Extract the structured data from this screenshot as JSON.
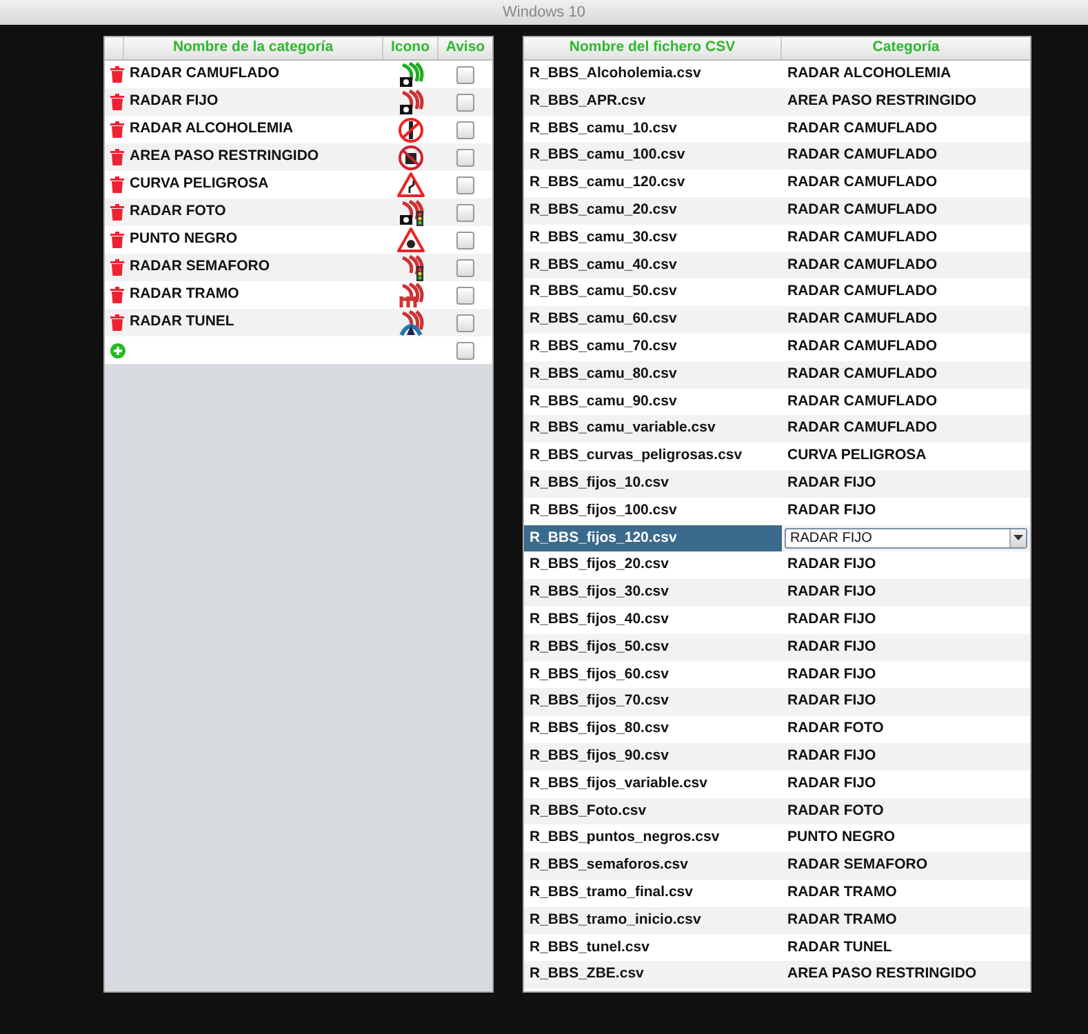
{
  "window": {
    "title": "Windows 10"
  },
  "categories": {
    "columns": [
      "Nombre de la categoría",
      "Icono",
      "Aviso"
    ],
    "rows": [
      {
        "name": "RADAR CAMUFLADO",
        "checked": false
      },
      {
        "name": "RADAR FIJO",
        "checked": false
      },
      {
        "name": "RADAR ALCOHOLEMIA",
        "checked": false
      },
      {
        "name": "AREA PASO RESTRINGIDO",
        "checked": false
      },
      {
        "name": "CURVA PELIGROSA",
        "checked": false
      },
      {
        "name": "RADAR FOTO",
        "checked": false
      },
      {
        "name": "PUNTO NEGRO",
        "checked": false
      },
      {
        "name": "RADAR SEMAFORO",
        "checked": false
      },
      {
        "name": "RADAR TRAMO",
        "checked": false
      },
      {
        "name": "RADAR TUNEL",
        "checked": false
      }
    ],
    "new_row": {
      "checked": false
    }
  },
  "files": {
    "columns": [
      "Nombre del fichero CSV",
      "Categoría"
    ],
    "rows": [
      {
        "file": "R_BBS_Alcoholemia.csv",
        "category": "RADAR ALCOHOLEMIA",
        "selected": false
      },
      {
        "file": "R_BBS_APR.csv",
        "category": "AREA PASO RESTRINGIDO",
        "selected": false
      },
      {
        "file": "R_BBS_camu_10.csv",
        "category": "RADAR CAMUFLADO",
        "selected": false
      },
      {
        "file": "R_BBS_camu_100.csv",
        "category": "RADAR CAMUFLADO",
        "selected": false
      },
      {
        "file": "R_BBS_camu_120.csv",
        "category": "RADAR CAMUFLADO",
        "selected": false
      },
      {
        "file": "R_BBS_camu_20.csv",
        "category": "RADAR CAMUFLADO",
        "selected": false
      },
      {
        "file": "R_BBS_camu_30.csv",
        "category": "RADAR CAMUFLADO",
        "selected": false
      },
      {
        "file": "R_BBS_camu_40.csv",
        "category": "RADAR CAMUFLADO",
        "selected": false
      },
      {
        "file": "R_BBS_camu_50.csv",
        "category": "RADAR CAMUFLADO",
        "selected": false
      },
      {
        "file": "R_BBS_camu_60.csv",
        "category": "RADAR CAMUFLADO",
        "selected": false
      },
      {
        "file": "R_BBS_camu_70.csv",
        "category": "RADAR CAMUFLADO",
        "selected": false
      },
      {
        "file": "R_BBS_camu_80.csv",
        "category": "RADAR CAMUFLADO",
        "selected": false
      },
      {
        "file": "R_BBS_camu_90.csv",
        "category": "RADAR CAMUFLADO",
        "selected": false
      },
      {
        "file": "R_BBS_camu_variable.csv",
        "category": "RADAR CAMUFLADO",
        "selected": false
      },
      {
        "file": "R_BBS_curvas_peligrosas.csv",
        "category": "CURVA PELIGROSA",
        "selected": false
      },
      {
        "file": "R_BBS_fijos_10.csv",
        "category": "RADAR FIJO",
        "selected": false
      },
      {
        "file": "R_BBS_fijos_100.csv",
        "category": "RADAR FIJO",
        "selected": false
      },
      {
        "file": "R_BBS_fijos_120.csv",
        "category": "RADAR FIJO",
        "selected": true
      },
      {
        "file": "R_BBS_fijos_20.csv",
        "category": "RADAR FIJO",
        "selected": false
      },
      {
        "file": "R_BBS_fijos_30.csv",
        "category": "RADAR FIJO",
        "selected": false
      },
      {
        "file": "R_BBS_fijos_40.csv",
        "category": "RADAR FIJO",
        "selected": false
      },
      {
        "file": "R_BBS_fijos_50.csv",
        "category": "RADAR FIJO",
        "selected": false
      },
      {
        "file": "R_BBS_fijos_60.csv",
        "category": "RADAR FIJO",
        "selected": false
      },
      {
        "file": "R_BBS_fijos_70.csv",
        "category": "RADAR FIJO",
        "selected": false
      },
      {
        "file": "R_BBS_fijos_80.csv",
        "category": "RADAR FOTO",
        "selected": false
      },
      {
        "file": "R_BBS_fijos_90.csv",
        "category": "RADAR FIJO",
        "selected": false
      },
      {
        "file": "R_BBS_fijos_variable.csv",
        "category": "RADAR FIJO",
        "selected": false
      },
      {
        "file": "R_BBS_Foto.csv",
        "category": "RADAR FOTO",
        "selected": false
      },
      {
        "file": "R_BBS_puntos_negros.csv",
        "category": "PUNTO NEGRO",
        "selected": false
      },
      {
        "file": "R_BBS_semaforos.csv",
        "category": "RADAR SEMAFORO",
        "selected": false
      },
      {
        "file": "R_BBS_tramo_final.csv",
        "category": "RADAR TRAMO",
        "selected": false
      },
      {
        "file": "R_BBS_tramo_inicio.csv",
        "category": "RADAR TRAMO",
        "selected": false
      },
      {
        "file": "R_BBS_tunel.csv",
        "category": "RADAR TUNEL",
        "selected": false
      },
      {
        "file": "R_BBS_ZBE.csv",
        "category": "AREA PASO RESTRINGIDO",
        "selected": false
      }
    ]
  }
}
